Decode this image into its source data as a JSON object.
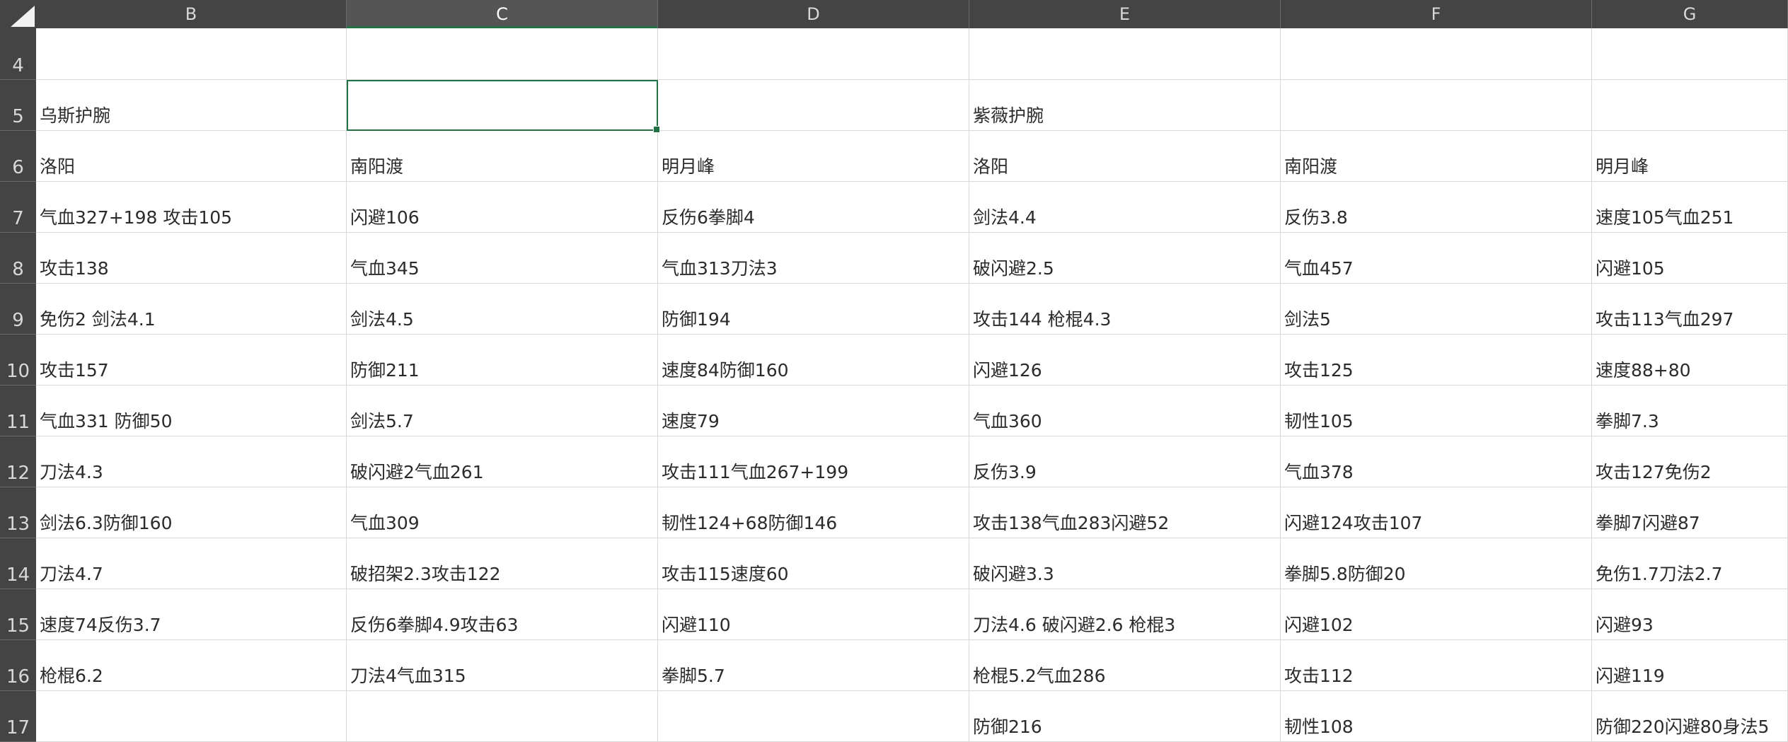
{
  "columns": [
    "B",
    "C",
    "D",
    "E",
    "F",
    "G"
  ],
  "selected_column": "C",
  "active_cell": "C5",
  "rows": [
    {
      "num": "4",
      "cells": [
        "",
        "",
        "",
        "",
        "",
        ""
      ]
    },
    {
      "num": "5",
      "cells": [
        "乌斯护腕",
        "",
        "",
        "紫薇护腕",
        "",
        ""
      ]
    },
    {
      "num": "6",
      "cells": [
        "洛阳",
        "南阳渡",
        "明月峰",
        "洛阳",
        "南阳渡",
        "明月峰"
      ]
    },
    {
      "num": "7",
      "cells": [
        "气血327+198 攻击105",
        "闪避106",
        "反伤6拳脚4",
        "剑法4.4",
        "反伤3.8",
        "速度105气血251"
      ]
    },
    {
      "num": "8",
      "cells": [
        "攻击138",
        "气血345",
        "气血313刀法3",
        "破闪避2.5",
        "气血457",
        "闪避105"
      ]
    },
    {
      "num": "9",
      "cells": [
        "免伤2  剑法4.1",
        "剑法4.5",
        "防御194",
        "攻击144 枪棍4.3",
        "剑法5",
        "攻击113气血297"
      ]
    },
    {
      "num": "10",
      "cells": [
        "攻击157",
        "防御211",
        "速度84防御160",
        "闪避126",
        "攻击125",
        "速度88+80"
      ]
    },
    {
      "num": "11",
      "cells": [
        "气血331  防御50",
        "剑法5.7",
        "速度79",
        "气血360",
        "韧性105",
        "拳脚7.3"
      ]
    },
    {
      "num": "12",
      "cells": [
        "刀法4.3",
        "破闪避2气血261",
        "攻击111气血267+199",
        "反伤3.9",
        "气血378",
        "攻击127免伤2"
      ]
    },
    {
      "num": "13",
      "cells": [
        "剑法6.3防御160",
        "气血309",
        "韧性124+68防御146",
        "攻击138气血283闪避52",
        "闪避124攻击107",
        "拳脚7闪避87"
      ]
    },
    {
      "num": "14",
      "cells": [
        "刀法4.7",
        "破招架2.3攻击122",
        "攻击115速度60",
        "破闪避3.3",
        "拳脚5.8防御20",
        "免伤1.7刀法2.7"
      ]
    },
    {
      "num": "15",
      "cells": [
        "速度74反伤3.7",
        "反伤6拳脚4.9攻击63",
        "闪避110",
        "刀法4.6 破闪避2.6 枪棍3",
        "闪避102",
        "闪避93"
      ]
    },
    {
      "num": "16",
      "cells": [
        "枪棍6.2",
        "刀法4气血315",
        "拳脚5.7",
        "枪棍5.2气血286",
        "攻击112",
        "闪避119"
      ]
    },
    {
      "num": "17",
      "cells": [
        "",
        "",
        "",
        "防御216",
        "韧性108",
        "防御220闪避80身法5"
      ]
    }
  ]
}
